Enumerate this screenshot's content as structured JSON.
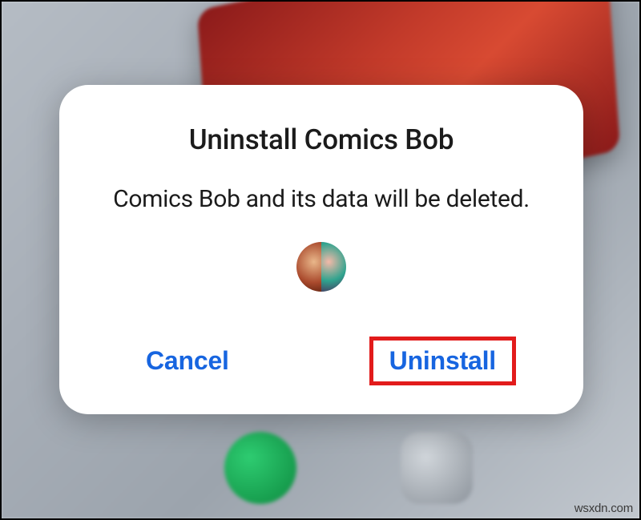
{
  "dialog": {
    "title": "Uninstall Comics Bob",
    "body": "Comics Bob and its data will be deleted.",
    "app_icon_name": "comics-bob-app-icon",
    "actions": {
      "cancel_label": "Cancel",
      "confirm_label": "Uninstall"
    }
  },
  "watermark": "wsxdn.com"
}
